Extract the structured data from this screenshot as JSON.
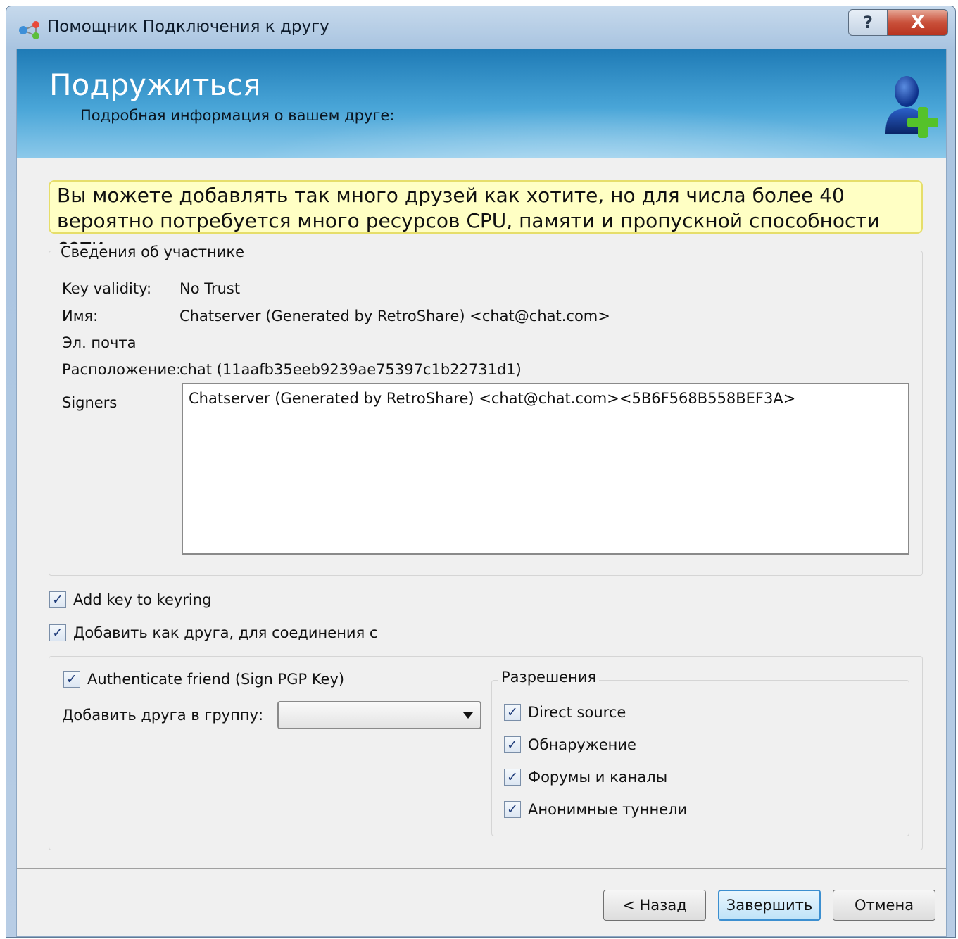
{
  "window": {
    "title": "Помощник Подключения к другу",
    "help_label": "?",
    "close_label": "X"
  },
  "banner": {
    "title": "Подружиться",
    "subtitle": "Подробная информация о вашем друге:"
  },
  "warning_text": "Вы можете добавлять так много друзей как хотите, но для числа более 40 вероятно потребуется много ресурсов CPU, памяти и пропускной способности сети.",
  "participant": {
    "group_title": "Сведения об участнике",
    "key_validity_label": "Key validity:",
    "key_validity_value": "No Trust",
    "name_label": "Имя:",
    "name_value": "Chatserver (Generated by RetroShare) <chat@chat.com>",
    "email_label": "Эл. почта",
    "email_value": "",
    "location_label": "Расположение:",
    "location_value": "chat (11aafb35eeb9239ae75397c1b22731d1)",
    "signers_label": "Signers",
    "signers_value": "Chatserver (Generated by RetroShare) <chat@chat.com><5B6F568B558BEF3A>"
  },
  "options": {
    "add_key_label": "Add key to keyring",
    "add_key_checked": true,
    "add_friend_label": "Добавить как друга, для соединения с",
    "add_friend_checked": true,
    "authenticate_label": "Authenticate friend (Sign PGP Key)",
    "authenticate_checked": true,
    "group_label": "Добавить друга в группу:",
    "group_value": ""
  },
  "permissions": {
    "title": "Разрешения",
    "items": [
      {
        "label": "Direct source",
        "checked": true
      },
      {
        "label": "Обнаружение",
        "checked": true
      },
      {
        "label": "Форумы и каналы",
        "checked": true
      },
      {
        "label": "Анонимные туннели",
        "checked": true
      }
    ]
  },
  "buttons": {
    "back": "< Назад",
    "finish": "Завершить",
    "cancel": "Отмена"
  },
  "check_mark": "✓",
  "colors": {
    "banner_top": "#1f7bb6",
    "banner_bottom": "#8cc9ea",
    "warning_bg": "#ffffc4",
    "warning_border": "#e6de6a"
  }
}
